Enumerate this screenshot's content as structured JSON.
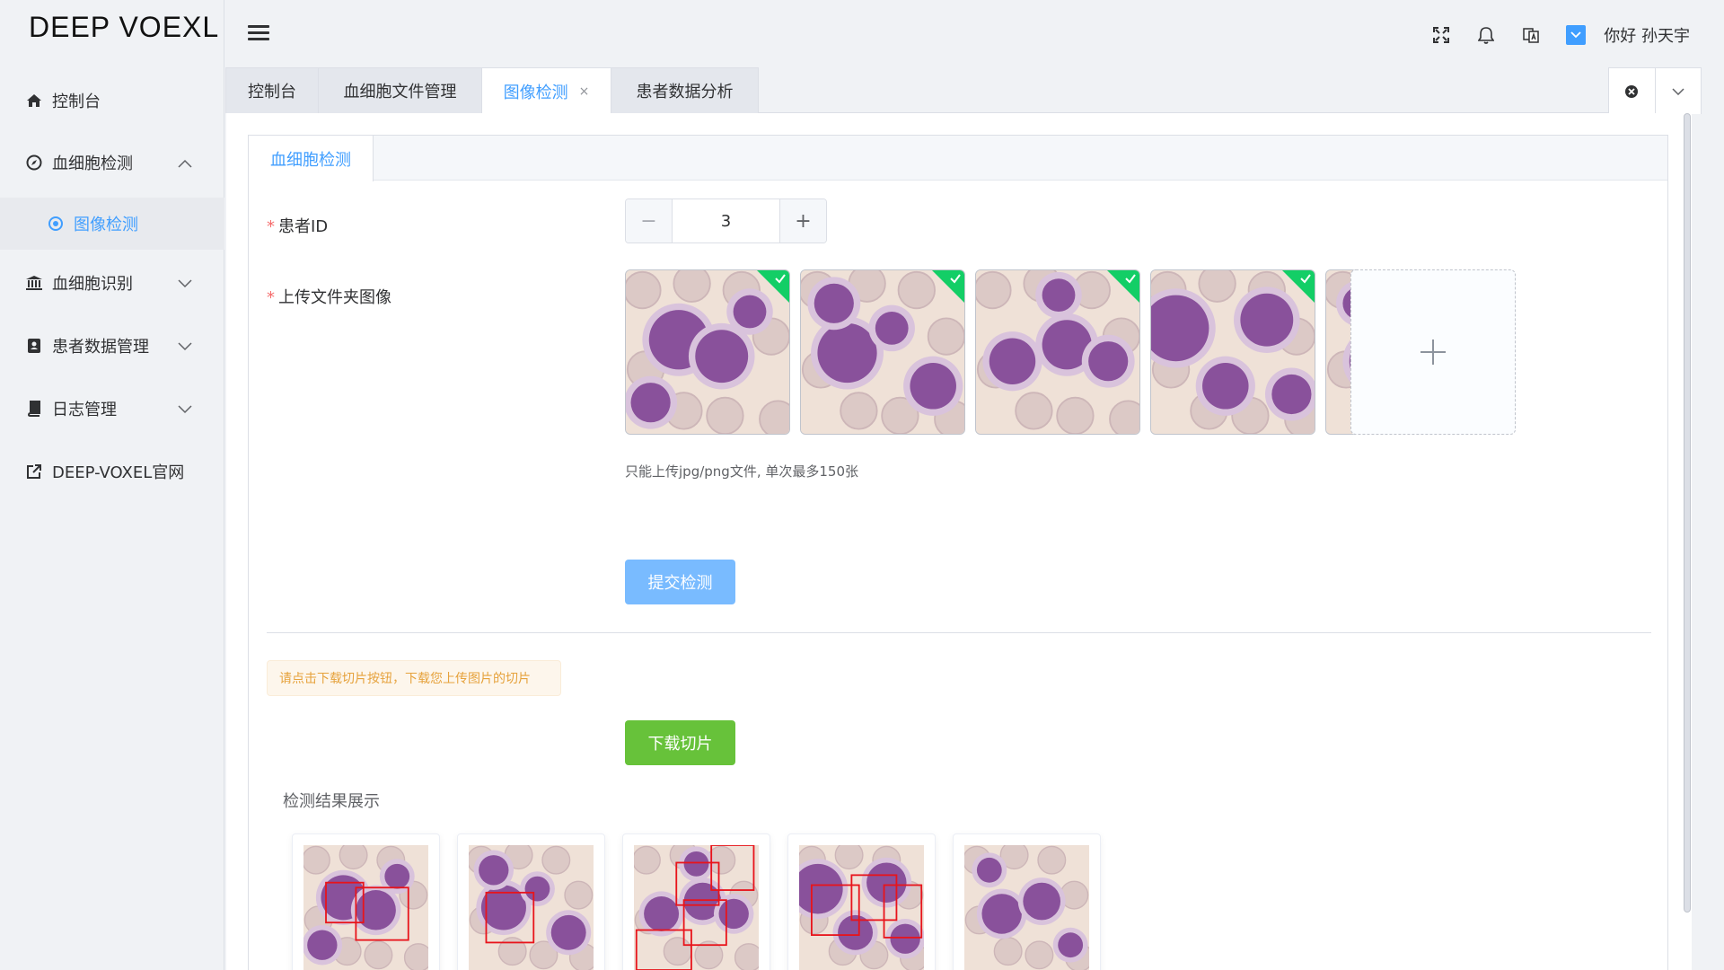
{
  "app": {
    "logo": "DEEP VOEXL"
  },
  "sidebar": {
    "items": [
      {
        "label": "控制台",
        "icon": "home-icon"
      },
      {
        "label": "血细胞检测",
        "icon": "compass-icon",
        "expanded": true
      },
      {
        "label": "图像检测",
        "icon": "target-icon",
        "active": true
      },
      {
        "label": "血细胞识别",
        "icon": "bank-icon"
      },
      {
        "label": "患者数据管理",
        "icon": "contact-book-icon"
      },
      {
        "label": "日志管理",
        "icon": "book-icon"
      },
      {
        "label": "DEEP-VOXEL官网",
        "icon": "external-link-icon"
      }
    ]
  },
  "header": {
    "greeting": "你好 孙天宇",
    "icons": [
      "fullscreen-icon",
      "bell-icon",
      "translate-icon",
      "avatar"
    ]
  },
  "tabs": [
    {
      "label": "控制台"
    },
    {
      "label": "血细胞文件管理"
    },
    {
      "label": "图像检测",
      "active": true,
      "close": "×"
    },
    {
      "label": "患者数据分析"
    }
  ],
  "form": {
    "card_tab": "血细胞检测",
    "patient_id_label": "患者ID",
    "patient_id_value": "3",
    "stepper_minus": "−",
    "stepper_plus": "+",
    "upload_label": "上传文件夹图像",
    "required_mark": "*",
    "uploaded_count": 5,
    "hint": "只能上传jpg/png文件, 单次最多150张",
    "submit_label": "提交检测",
    "alert": "请点击下载切片按钮，下载您上传图片的切片",
    "download_label": "下载切片",
    "results_title": "检测结果展示",
    "results_count": 5
  },
  "colors": {
    "primary": "#409eff",
    "primary_light": "#79bbff",
    "success": "#67c23a",
    "warning": "#e6a23c",
    "danger": "#f56c6c",
    "cell_purple": "#7a3d8f",
    "smear_bg": "#efe1d7",
    "detection_box": "#e8141b"
  }
}
